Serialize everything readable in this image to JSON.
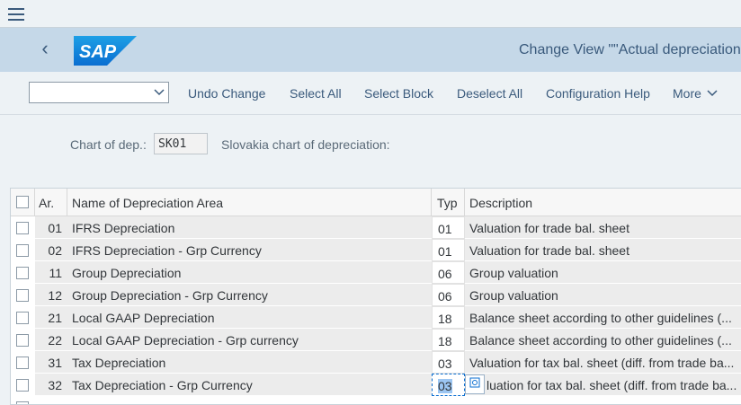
{
  "shell": {
    "title": "Change View \"\"Actual depreciation",
    "logo_text": "SAP"
  },
  "toolbar": {
    "select_value": "",
    "buttons": [
      "Undo Change",
      "Select All",
      "Select Block",
      "Deselect All",
      "Configuration Help",
      "More"
    ]
  },
  "header": {
    "chart_label": "Chart of dep.:",
    "chart_value": "SK01",
    "chart_desc": "Slovakia chart of depreciation:"
  },
  "table": {
    "columns": [
      "Ar.",
      "Name of Depreciation Area",
      "Typ",
      "Description"
    ],
    "rows": [
      {
        "ar": "01",
        "name": "IFRS Depreciation",
        "typ": "01",
        "desc": "Valuation for trade bal. sheet"
      },
      {
        "ar": "02",
        "name": "IFRS Depreciation - Grp Currency",
        "typ": "01",
        "desc": "Valuation for trade bal. sheet"
      },
      {
        "ar": "11",
        "name": "Group Depreciation",
        "typ": "06",
        "desc": "Group valuation"
      },
      {
        "ar": "12",
        "name": "Group Depreciation - Grp Currency",
        "typ": "06",
        "desc": "Group valuation"
      },
      {
        "ar": "21",
        "name": "Local GAAP Depreciation",
        "typ": "18",
        "desc": "Balance sheet according to other guidelines (..."
      },
      {
        "ar": "22",
        "name": "Local GAAP Depreciation - Grp currency",
        "typ": "18",
        "desc": "Balance sheet according to other guidelines (..."
      },
      {
        "ar": "31",
        "name": "Tax Depreciation",
        "typ": "03",
        "desc": "Valuation for tax bal. sheet (diff. from trade ba..."
      },
      {
        "ar": "32",
        "name": "Tax Depreciation - Grp Currency",
        "typ": "03",
        "desc": "luation for tax bal. sheet (diff. from trade ba..."
      }
    ]
  },
  "colors": {
    "shell_bg": "#c5d8e8",
    "accent": "#3a5a7c",
    "focus": "#0a6ed1"
  },
  "icons": [
    "menu-icon",
    "back-icon",
    "chevron-down-icon",
    "value-help-icon"
  ]
}
